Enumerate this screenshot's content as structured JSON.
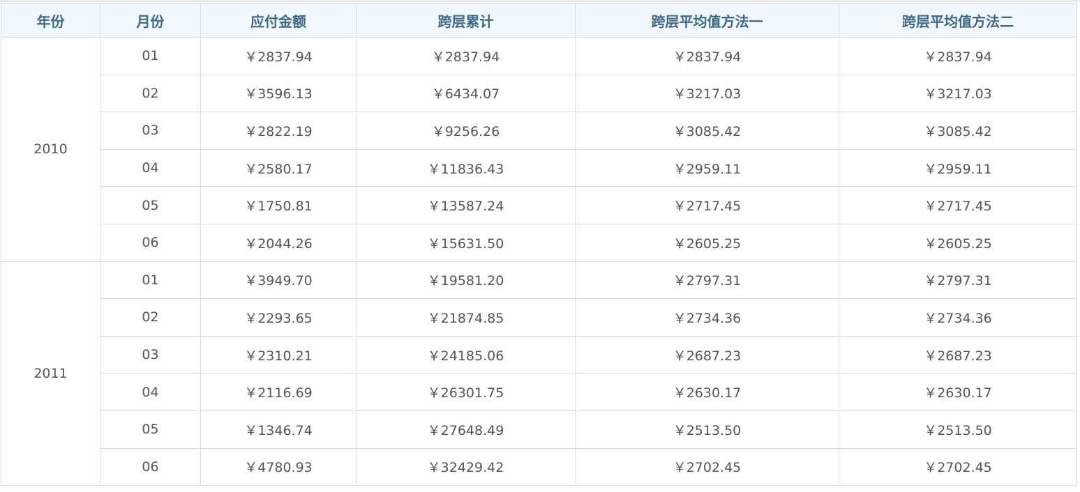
{
  "table": {
    "headers": [
      "年份",
      "月份",
      "应付金额",
      "跨层累计",
      "跨层平均值方法一",
      "跨层平均值方法二"
    ],
    "groups": [
      {
        "year": "2010",
        "rows": [
          {
            "month": "01",
            "amount": "￥2837.94",
            "cumulative": "￥2837.94",
            "avg1": "￥2837.94",
            "avg2": "￥2837.94"
          },
          {
            "month": "02",
            "amount": "￥3596.13",
            "cumulative": "￥6434.07",
            "avg1": "￥3217.03",
            "avg2": "￥3217.03"
          },
          {
            "month": "03",
            "amount": "￥2822.19",
            "cumulative": "￥9256.26",
            "avg1": "￥3085.42",
            "avg2": "￥3085.42"
          },
          {
            "month": "04",
            "amount": "￥2580.17",
            "cumulative": "￥11836.43",
            "avg1": "￥2959.11",
            "avg2": "￥2959.11"
          },
          {
            "month": "05",
            "amount": "￥1750.81",
            "cumulative": "￥13587.24",
            "avg1": "￥2717.45",
            "avg2": "￥2717.45"
          },
          {
            "month": "06",
            "amount": "￥2044.26",
            "cumulative": "￥15631.50",
            "avg1": "￥2605.25",
            "avg2": "￥2605.25"
          }
        ]
      },
      {
        "year": "2011",
        "rows": [
          {
            "month": "01",
            "amount": "￥3949.70",
            "cumulative": "￥19581.20",
            "avg1": "￥2797.31",
            "avg2": "￥2797.31"
          },
          {
            "month": "02",
            "amount": "￥2293.65",
            "cumulative": "￥21874.85",
            "avg1": "￥2734.36",
            "avg2": "￥2734.36"
          },
          {
            "month": "03",
            "amount": "￥2310.21",
            "cumulative": "￥24185.06",
            "avg1": "￥2687.23",
            "avg2": "￥2687.23"
          },
          {
            "month": "04",
            "amount": "￥2116.69",
            "cumulative": "￥26301.75",
            "avg1": "￥2630.17",
            "avg2": "￥2630.17"
          },
          {
            "month": "05",
            "amount": "￥1346.74",
            "cumulative": "￥27648.49",
            "avg1": "￥2513.50",
            "avg2": "￥2513.50"
          },
          {
            "month": "06",
            "amount": "￥4780.93",
            "cumulative": "￥32429.42",
            "avg1": "￥2702.45",
            "avg2": "￥2702.45"
          }
        ]
      }
    ]
  },
  "colors": {
    "header_bg": "#f1f8fd",
    "header_text": "#3d6887",
    "cell_text": "#555555",
    "border": "#dcdcdc"
  }
}
